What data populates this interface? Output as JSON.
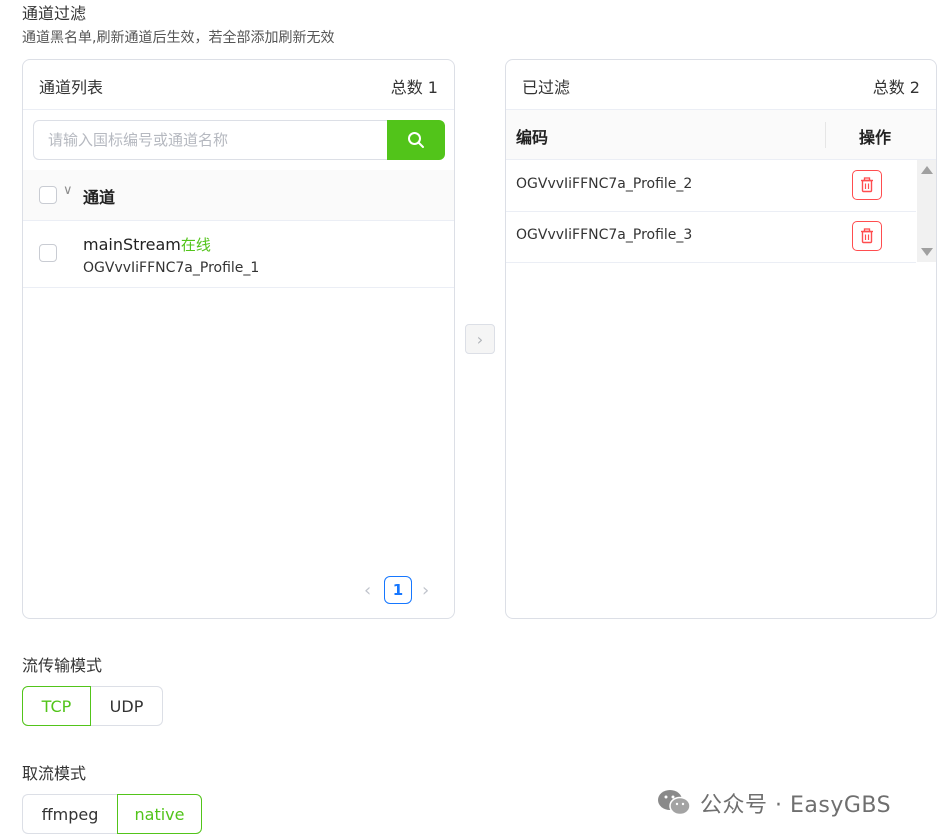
{
  "section": {
    "title": "通道过滤",
    "description": "通道黑名单,刷新通道后生效，若全部添加刷新无效"
  },
  "left_panel": {
    "title": "通道列表",
    "count_text": "总数 1",
    "search": {
      "placeholder": "请输入国标编号或通道名称",
      "value": ""
    },
    "header_label": "通道",
    "items": [
      {
        "name": "mainStream",
        "status": "在线",
        "code": "OGVvvIiFFNC7a_Profile_1",
        "checked": false
      }
    ],
    "pagination": {
      "current_page": "1"
    }
  },
  "right_panel": {
    "title": "已过滤",
    "count_text": "总数 2",
    "columns": [
      "编码",
      "操作"
    ],
    "rows": [
      {
        "code": "OGVvvIiFFNC7a_Profile_2"
      },
      {
        "code": "OGVvvIiFFNC7a_Profile_3"
      }
    ]
  },
  "stream_transport": {
    "label": "流传输模式",
    "options": [
      "TCP",
      "UDP"
    ],
    "selected": "TCP"
  },
  "pull_mode": {
    "label": "取流模式",
    "options": [
      "ffmpeg",
      "native"
    ],
    "selected": "native"
  },
  "watermark": {
    "text": "公众号 · EasyGBS"
  },
  "colors": {
    "accent": "#52c41a",
    "danger": "#ff4d4f",
    "link": "#1677ff"
  }
}
